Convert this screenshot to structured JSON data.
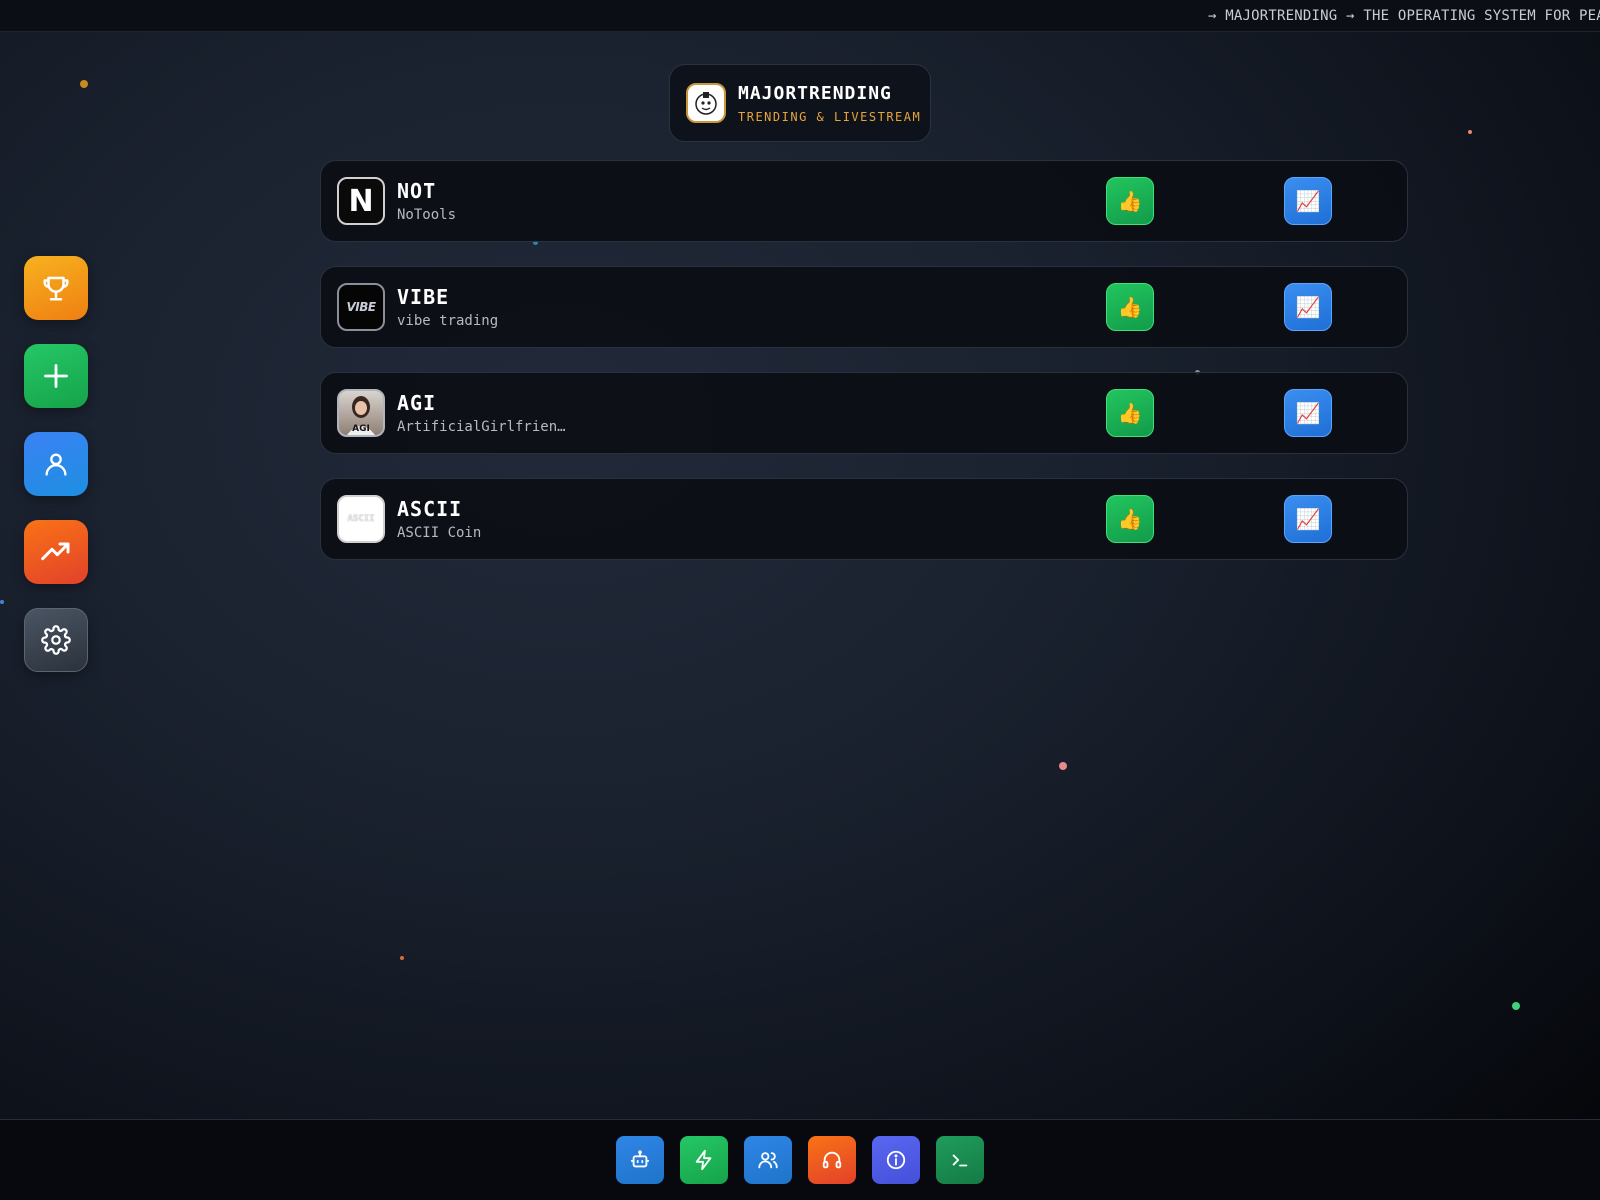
{
  "ticker": {
    "text": "→ MAJORTRENDING → THE OPERATING SYSTEM FOR PEAK"
  },
  "brand": {
    "title": "MAJORTRENDING",
    "subtitle": "TRENDING & LIVESTREAM",
    "accent_color": "#e8a33a"
  },
  "sidebar": {
    "items": [
      {
        "name": "leaderboard",
        "icon": "trophy-icon",
        "color": "#f5a623"
      },
      {
        "name": "add",
        "icon": "plus-icon",
        "color": "#22c55e"
      },
      {
        "name": "profile",
        "icon": "user-icon",
        "color": "#3b82f6"
      },
      {
        "name": "trending",
        "icon": "trending-up-icon",
        "color": "#f97316"
      },
      {
        "name": "settings",
        "icon": "gear-icon",
        "color": "#374151"
      }
    ]
  },
  "tokens": [
    {
      "symbol": "NOT",
      "name": "NoTools",
      "logo_text": "N",
      "like_icon": "👍",
      "chart_icon": "📈"
    },
    {
      "symbol": "VIBE",
      "name": "vibe trading",
      "logo_text": "VIBE",
      "like_icon": "👍",
      "chart_icon": "📈"
    },
    {
      "symbol": "AGI",
      "name": "ArtificialGirlfrien…",
      "logo_text": "AGI",
      "like_icon": "👍",
      "chart_icon": "📈"
    },
    {
      "symbol": "ASCII",
      "name": "ASCII Coin",
      "logo_text": "ASCII",
      "like_icon": "👍",
      "chart_icon": "📈"
    }
  ],
  "dock": {
    "items": [
      {
        "name": "bot",
        "icon": "robot-icon",
        "color": "#2f86e6"
      },
      {
        "name": "boost",
        "icon": "lightning-icon",
        "color": "#22c55e"
      },
      {
        "name": "community",
        "icon": "users-icon",
        "color": "#2f86e6"
      },
      {
        "name": "support",
        "icon": "headphones-icon",
        "color": "#f97316"
      },
      {
        "name": "info",
        "icon": "info-icon",
        "color": "#5a67f2"
      },
      {
        "name": "terminal",
        "icon": "terminal-icon",
        "color": "#1f9d5c"
      }
    ]
  }
}
